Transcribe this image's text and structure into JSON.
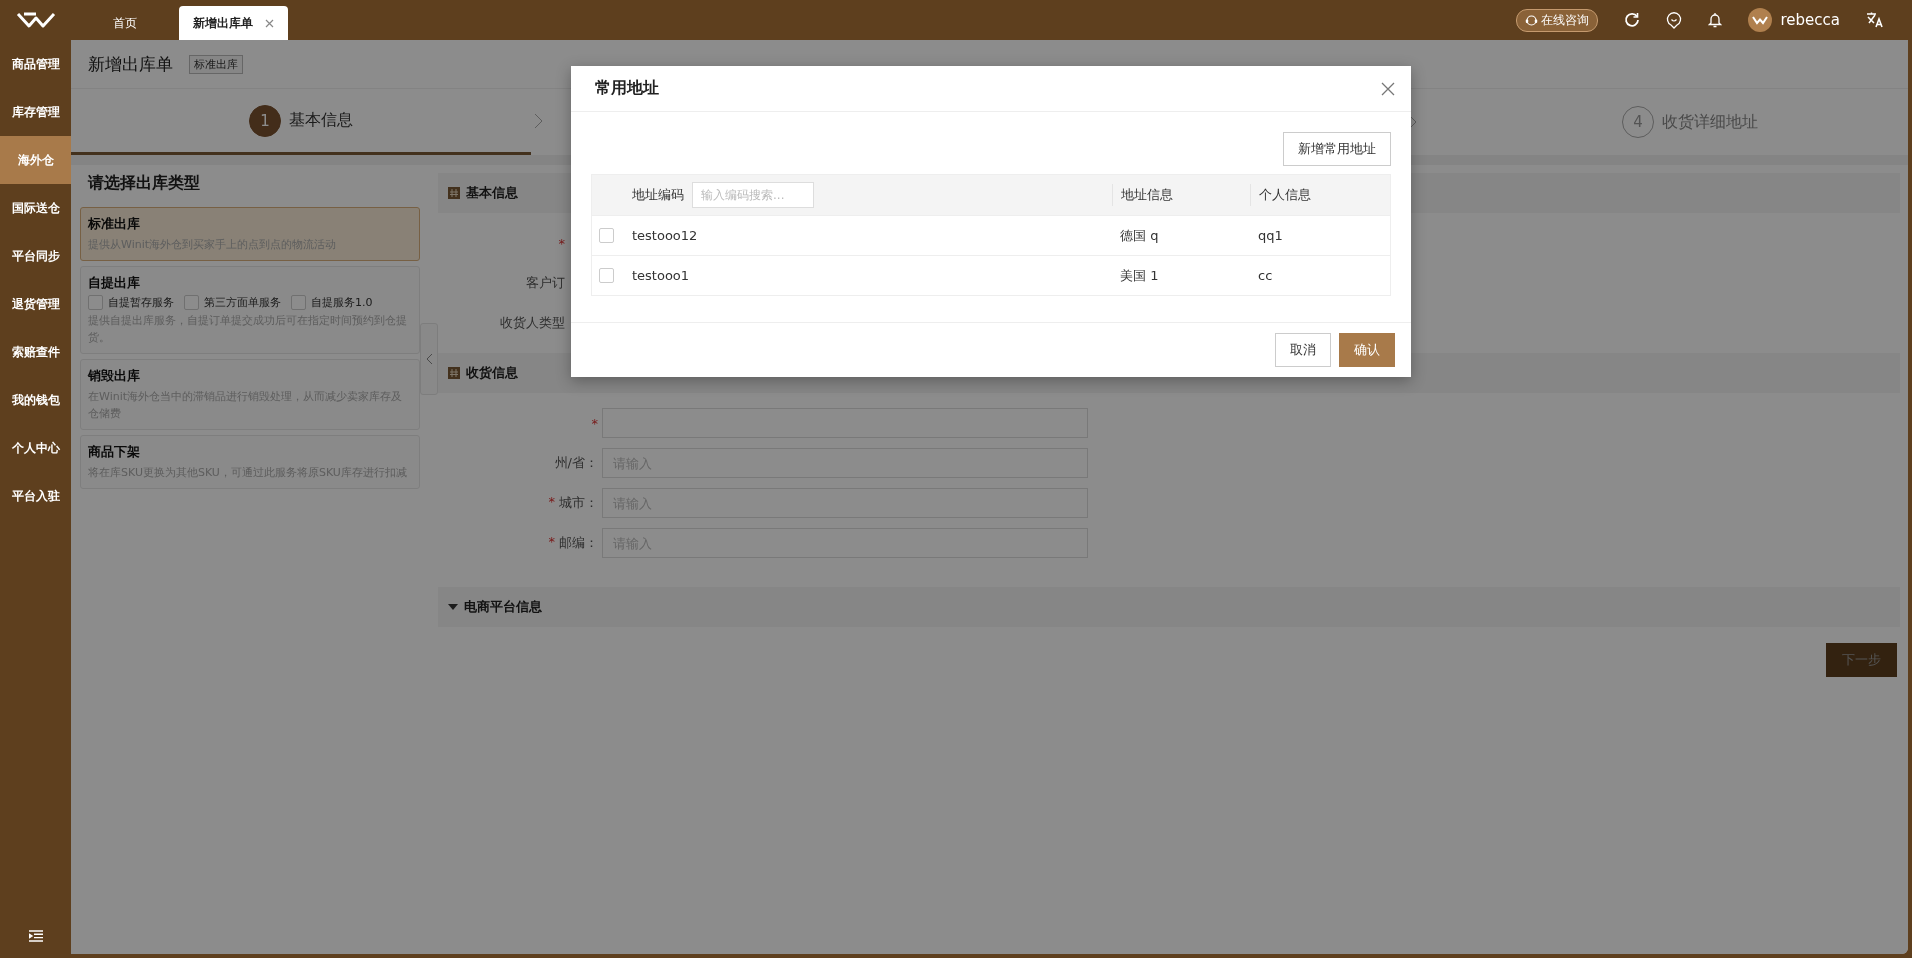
{
  "topbar": {
    "tabs": [
      {
        "label": "首页",
        "selected": false,
        "closable": false
      },
      {
        "label": "新增出库单",
        "selected": true,
        "closable": true
      }
    ],
    "consult": "在线咨询",
    "username": "rebecca"
  },
  "sidebar": {
    "items": [
      {
        "label": "商品管理",
        "selected": false
      },
      {
        "label": "库存管理",
        "selected": false
      },
      {
        "label": "海外仓",
        "selected": true
      },
      {
        "label": "国际送仓",
        "selected": false
      },
      {
        "label": "平台同步",
        "selected": false
      },
      {
        "label": "退货管理",
        "selected": false
      },
      {
        "label": "索赔查件",
        "selected": false
      },
      {
        "label": "我的钱包",
        "selected": false
      },
      {
        "label": "个人中心",
        "selected": false
      },
      {
        "label": "平台入驻",
        "selected": false
      }
    ]
  },
  "page": {
    "title": "新增出库单",
    "tag": "标准出库"
  },
  "steps": [
    {
      "number": "1",
      "label": "基本信息",
      "selected": true
    },
    {
      "number": "4",
      "label": "收货详细地址",
      "selected": false
    }
  ],
  "type_panel": {
    "heading": "请选择出库类型",
    "options": [
      {
        "title": "标准出库",
        "description": "提供从Winit海外仓到买家手上的点到点的物流活动",
        "selected": true
      },
      {
        "title": "自提出库",
        "description": "提供自提出库服务，自提订单提交成功后可在指定时间预约到仓提货。",
        "selected": false,
        "checkboxes": [
          {
            "label": "自提暂存服务",
            "checked": false
          },
          {
            "label": "第三方面单服务",
            "checked": false
          },
          {
            "label": "自提服务1.0",
            "checked": false
          }
        ]
      },
      {
        "title": "销毁出库",
        "description": "在Winit海外仓当中的滞销品进行销毁处理，从而减少卖家库存及仓储费",
        "selected": false
      },
      {
        "title": "商品下架",
        "description": "将在库SKU更换为其他SKU，可通过此服务将原SKU库存进行扣减",
        "selected": false
      }
    ]
  },
  "form": {
    "basic": {
      "title": "基本信息",
      "fields": [
        {
          "star": "*"
        },
        {
          "label": "客户订"
        },
        {
          "label": "收货人类型"
        }
      ]
    },
    "receiving": {
      "title": "收货信息",
      "fields": [
        {
          "star": "*"
        },
        {
          "label": "州/省：",
          "placeholder": "请输入"
        },
        {
          "star": "*",
          "label": "城市：",
          "placeholder": "请输入"
        },
        {
          "star": "*",
          "label": "邮编：",
          "placeholder": "请输入"
        }
      ]
    },
    "ecommerce": {
      "title": "电商平台信息",
      "expanded": true
    },
    "next_button": "下一步"
  },
  "modal": {
    "title": "常用地址",
    "add_button": "新增常用地址",
    "search_placeholder": "输入编码搜索...",
    "columns": [
      "地址编码",
      "地址信息",
      "个人信息"
    ],
    "rows": [
      {
        "code": "testooo12",
        "address": "德国 q",
        "personal": "qq1",
        "selected": false
      },
      {
        "code": "testooo1",
        "address": "美国 1",
        "personal": "cc",
        "selected": false
      }
    ],
    "cancel": "取消",
    "confirm": "确认"
  }
}
